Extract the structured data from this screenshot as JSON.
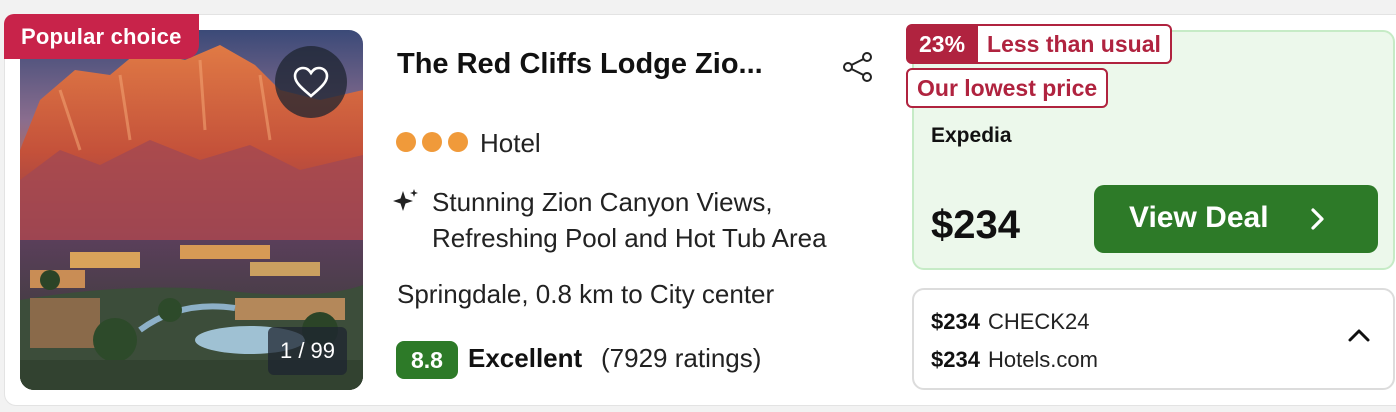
{
  "listing": {
    "badge": "Popular choice",
    "photo_counter": "1 / 99",
    "title": "The Red Cliffs Lodge Zio...",
    "star_rating": 3,
    "type": "Hotel",
    "amenities_line1": "Stunning Zion Canyon Views,",
    "amenities_line2": "Refreshing Pool and Hot Tub Area",
    "location": "Springdale, 0.8 km to City center",
    "score": "8.8",
    "rating_word": "Excellent",
    "rating_count": "(7929 ratings)"
  },
  "deal": {
    "discount": "23%",
    "discount_label": "Less than usual",
    "lowest_label": "Our lowest price",
    "provider": "Expedia",
    "price": "$234",
    "button_label": "View Deal"
  },
  "other_offers": [
    {
      "price": "$234",
      "provider": "CHECK24"
    },
    {
      "price": "$234",
      "provider": "Hotels.com"
    }
  ],
  "colors": {
    "badge_red": "#c8234a",
    "deal_green": "#2d7a28",
    "star_orange": "#f09a3a"
  },
  "icons": [
    "heart-icon",
    "share-icon",
    "sparkle-icon",
    "chevron-right-icon",
    "chevron-up-icon"
  ]
}
